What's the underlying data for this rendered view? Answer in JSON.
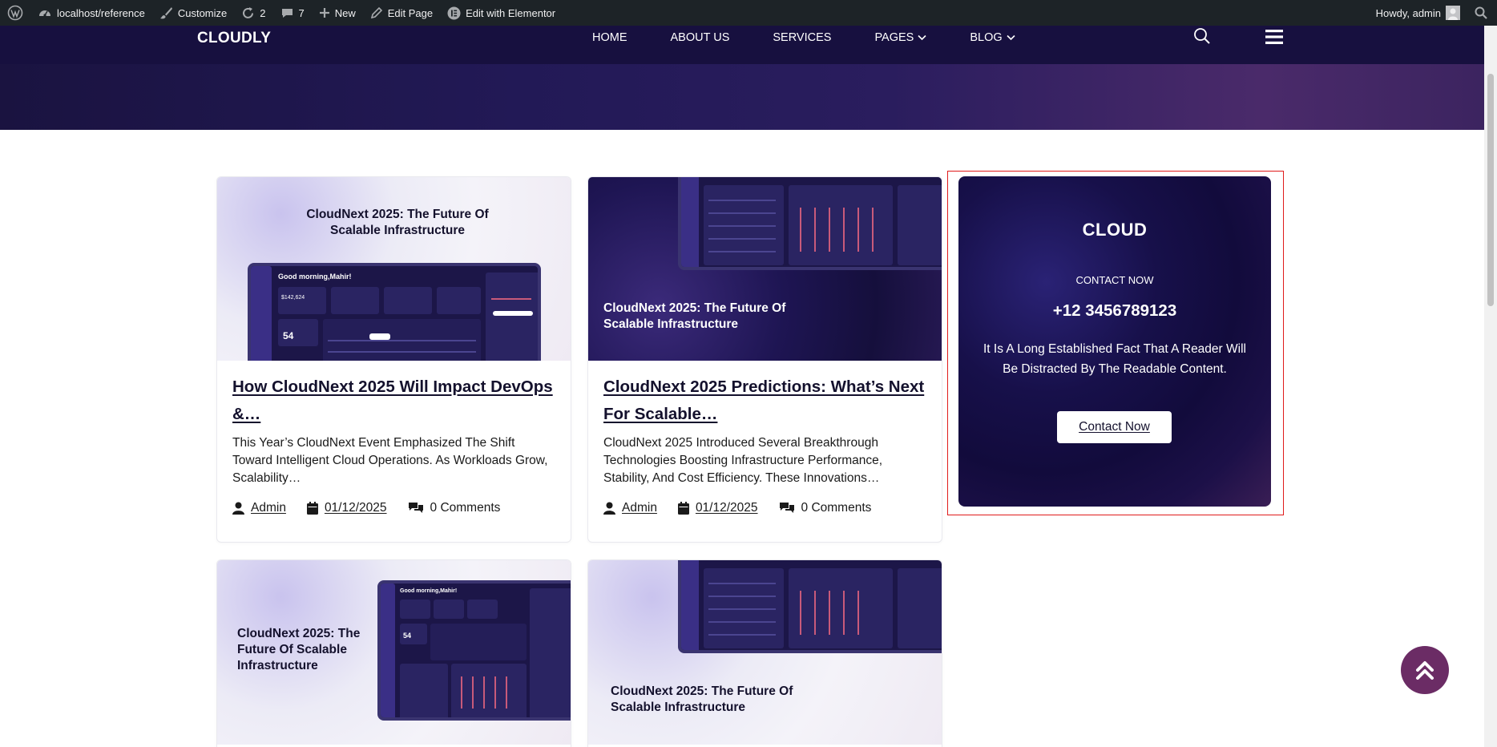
{
  "admin_bar": {
    "site": "localhost/reference",
    "customize": "Customize",
    "updates_count": "2",
    "comments_count": "7",
    "new_label": "New",
    "edit_page": "Edit Page",
    "elementor": "Edit with Elementor",
    "howdy": "Howdy, admin"
  },
  "header": {
    "logo": "CLOUDLY",
    "nav": [
      {
        "label": "HOME"
      },
      {
        "label": "ABOUT US"
      },
      {
        "label": "SERVICES"
      },
      {
        "label": "PAGES"
      },
      {
        "label": "BLOG"
      }
    ]
  },
  "posts": [
    {
      "thumb_title": "CloudNext 2025: The Future Of Scalable Infrastructure",
      "thumb_greeting": "Good morning,Mahir!",
      "thumb_stat": "$142,624",
      "thumb_count": "54",
      "title": "How CloudNext 2025 Will Impact DevOps &…",
      "excerpt": "This Year’s CloudNext Event Emphasized The Shift Toward Intelligent Cloud Operations. As Workloads Grow, Scalability…",
      "author": "Admin",
      "date": "01/12/2025",
      "comments": "0 Comments"
    },
    {
      "thumb_title": "CloudNext 2025: The Future Of Scalable Infrastructure",
      "title": "CloudNext 2025 Predictions: What’s Next For Scalable…",
      "excerpt": "CloudNext 2025 Introduced Several Breakthrough Technologies Boosting Infrastructure Performance, Stability, And Cost Efficiency. These Innovations…",
      "author": "Admin",
      "date": "01/12/2025",
      "comments": "0 Comments"
    },
    {
      "thumb_title": "CloudNext 2025: The Future Of Scalable Infrastructure",
      "thumb_greeting": "Good morning,Mahir!",
      "thumb_count": "54"
    },
    {
      "thumb_title": "CloudNext 2025: The Future Of Scalable Infrastructure"
    }
  ],
  "cta": {
    "title": "CLOUD",
    "subtitle": "CONTACT NOW",
    "phone": "+12 3456789123",
    "description": "It Is A Long Established Fact That A Reader Will Be Distracted By The Readable Content.",
    "button": "Contact Now"
  },
  "colors": {
    "header_bg": "#17103f",
    "admin_bar_bg": "#1d2327",
    "cta_bg": "#120b3c",
    "scroll_top_bg": "#6b2c65",
    "highlight_border": "#e01b1b"
  }
}
